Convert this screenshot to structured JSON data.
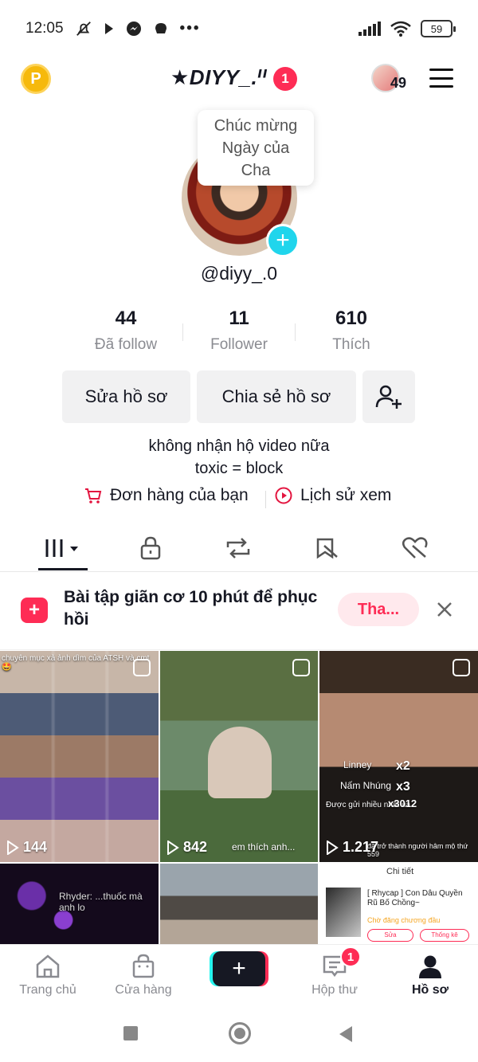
{
  "status_bar": {
    "time": "12:05",
    "battery": "59"
  },
  "header": {
    "coin_label": "P",
    "title": "★DIYY_.ᑊᑊ",
    "notification_count": "1",
    "avatar_count": "49"
  },
  "tooltip": {
    "lines": [
      "Chúc mừng",
      "Ngày của",
      "Cha"
    ]
  },
  "profile": {
    "handle": "@diyy_.0",
    "stats": [
      {
        "value": "44",
        "label": "Đã follow"
      },
      {
        "value": "11",
        "label": "Follower"
      },
      {
        "value": "610",
        "label": "Thích"
      }
    ],
    "edit_button": "Sửa hồ sơ",
    "share_button": "Chia sẻ hồ sơ",
    "bio": [
      "không nhận hộ video nữa",
      "toxic = block"
    ],
    "orders_link": "Đơn hàng của bạn",
    "history_link": "Lịch sử xem"
  },
  "promo": {
    "text": "Bài tập giãn cơ 10 phút để phục hồi",
    "button": "Tha..."
  },
  "videos": [
    {
      "views": "144",
      "caption": "chuyên mục xả ảnh dìm của ATSH và cmt🤩"
    },
    {
      "views": "842",
      "caption": "em thích anh..."
    },
    {
      "views": "1.217",
      "caption": "đã trở thành người hâm mộ thứ 559"
    },
    {
      "views": "",
      "caption": "Rhyder: ...thuốc mà anh lo"
    },
    {
      "views": "",
      "caption": ""
    },
    {
      "views": "",
      "caption": "Chi tiết"
    }
  ],
  "video_overlay": {
    "comment1_name": "Linney",
    "comment1_x": "x2",
    "comment2_name": "Nấm Nhúng",
    "comment2_x": "x3",
    "gift_line": "Được gửi nhiều nhất ủa",
    "gift_count": "x3012",
    "product_title": "[ Rhycap ] Con Dâu Quyền Rũ Bố Chồng~",
    "product_status": "Chờ đăng chương đầu",
    "product_btn1": "Sửa",
    "product_btn2": "Thống kê"
  },
  "bottom_nav": {
    "home": "Trang chủ",
    "shop": "Cửa hàng",
    "inbox": "Hộp thư",
    "inbox_badge": "1",
    "profile": "Hồ sơ"
  },
  "colors": {
    "accent": "#fe2c55",
    "cyan": "#20d5ec",
    "text": "#161823",
    "muted": "#8a8b91"
  }
}
